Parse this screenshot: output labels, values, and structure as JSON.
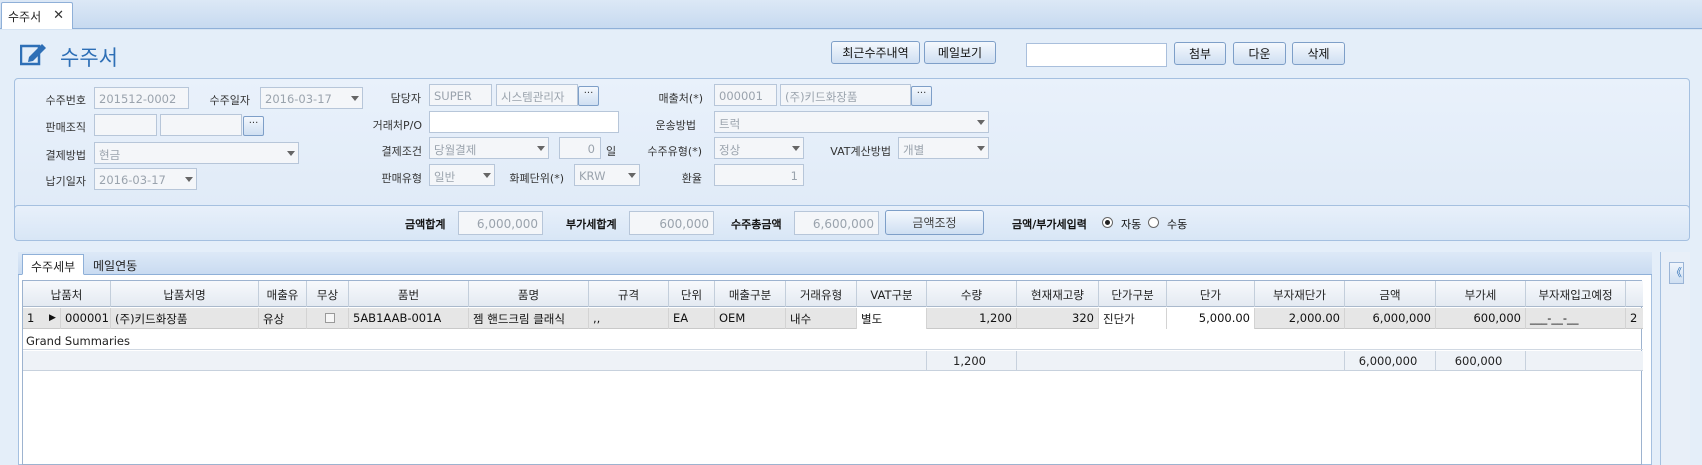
{
  "tab": {
    "title": "수주서",
    "close": "✕"
  },
  "page_title": "수주서",
  "toolbar": {
    "recent_orders": "최근수주내역",
    "view_mail": "메일보기",
    "search_value": "",
    "attach": "첨부",
    "next": "다운",
    "delete": "삭제"
  },
  "form": {
    "order_no_label": "수주번호",
    "order_no": "201512-0002",
    "order_date_label": "수주일자",
    "order_date": "2016-03-17",
    "manager_label": "담당자",
    "manager_code": "SUPER",
    "manager_name": "시스템관리자",
    "sales_dest_label": "매출처(*)",
    "sales_dest_code": "000001",
    "sales_dest_name": "(주)키드화장품",
    "sales_org_label": "판매조직",
    "client_po_label": "거래처P/O",
    "shipping_label": "운송방법",
    "shipping": "트럭",
    "payment_method_label": "결제방법",
    "payment_method": "현금",
    "payment_terms_label": "결제조건",
    "payment_terms": "당월결제",
    "payment_days": "0",
    "payment_days_unit": "일",
    "order_type_label": "수주유형(*)",
    "order_type": "정상",
    "vat_calc_label": "VAT계산방법",
    "vat_calc": "개별",
    "sales_type_label": "판매유형",
    "sales_type": "일반",
    "currency_label": "화폐단위(*)",
    "currency": "KRW",
    "exchange_label": "환율",
    "exchange": "1",
    "delivery_date_label": "납기일자",
    "delivery_date": "2016-03-17"
  },
  "summary": {
    "amount_label": "금액합계",
    "amount": "6,000,000",
    "vat_label": "부가세합계",
    "vat": "600,000",
    "total_label": "수주총금액",
    "total": "6,600,000",
    "adjust_button": "금액조정",
    "input_mode_label": "금액/부가세입력",
    "auto_label": "자동",
    "manual_label": "수동",
    "selected_mode": "auto"
  },
  "detail_tabs": [
    "수주세부",
    "메일연동"
  ],
  "grid": {
    "columns": [
      "납품처",
      "납품처명",
      "매출유",
      "무상",
      "품번",
      "품명",
      "규격",
      "단위",
      "매출구분",
      "거래유형",
      "VAT구분",
      "수량",
      "현재재고량",
      "단가구분",
      "단가",
      "부자재단가",
      "금액",
      "부가세",
      "부자재입고예정"
    ],
    "row": {
      "index": "1",
      "marker": "▶",
      "cells": [
        "000001",
        "(주)키드화장품",
        "유상",
        "",
        "5AB1AAB-001A",
        "젬 핸드크림 클래식",
        ",,",
        "EA",
        "OEM",
        "내수",
        "별도",
        "1,200",
        "320",
        "진단가",
        "5,000.00",
        "2,000.00",
        "6,000,000",
        "600,000",
        "___-__-__"
      ]
    },
    "trailing": "2",
    "group_label": "Grand Summaries",
    "totals": {
      "qty": "1,200",
      "amount": "6,000,000",
      "vat": "600,000"
    }
  },
  "side_collapse": "《"
}
